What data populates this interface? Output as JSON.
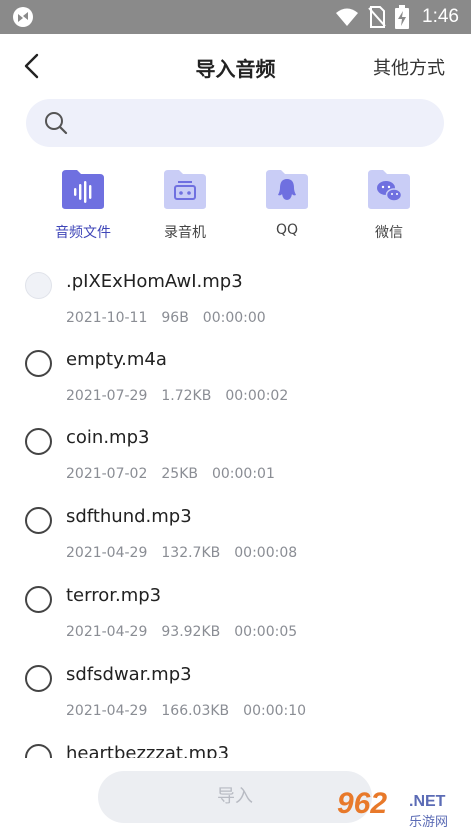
{
  "status_bar": {
    "time": "1:46"
  },
  "header": {
    "title": "导入音频",
    "other_label": "其他方式"
  },
  "search": {
    "placeholder": ""
  },
  "sources": [
    {
      "label": "音频文件",
      "icon": "audio-wave-icon",
      "active": true
    },
    {
      "label": "录音机",
      "icon": "recorder-icon",
      "active": false
    },
    {
      "label": "QQ",
      "icon": "qq-icon",
      "active": false
    },
    {
      "label": "微信",
      "icon": "wechat-icon",
      "active": false
    }
  ],
  "files": [
    {
      "name": ".pIXExHomAwI.mp3",
      "date": "2021-10-11",
      "size": "96B",
      "duration": "00:00:00",
      "disabled": true
    },
    {
      "name": "empty.m4a",
      "date": "2021-07-29",
      "size": "1.72KB",
      "duration": "00:00:02",
      "disabled": false
    },
    {
      "name": "coin.mp3",
      "date": "2021-07-02",
      "size": "25KB",
      "duration": "00:00:01",
      "disabled": false
    },
    {
      "name": "sdfthund.mp3",
      "date": "2021-04-29",
      "size": "132.7KB",
      "duration": "00:00:08",
      "disabled": false
    },
    {
      "name": "terror.mp3",
      "date": "2021-04-29",
      "size": "93.92KB",
      "duration": "00:00:05",
      "disabled": false
    },
    {
      "name": "sdfsdwar.mp3",
      "date": "2021-04-29",
      "size": "166.03KB",
      "duration": "00:00:10",
      "disabled": false
    },
    {
      "name": "heartbezzzat.mp3",
      "date": "",
      "size": "",
      "duration": "",
      "disabled": false
    }
  ],
  "import_button": {
    "label": "导入"
  },
  "watermark": {
    "number": "962",
    "net": ".NET",
    "site": "乐游网"
  },
  "colors": {
    "accent": "#3f46b8",
    "folder_active": "#6f70e0",
    "folder_inactive": "#c9cdf6",
    "status_bar": "#8a8a8a"
  }
}
